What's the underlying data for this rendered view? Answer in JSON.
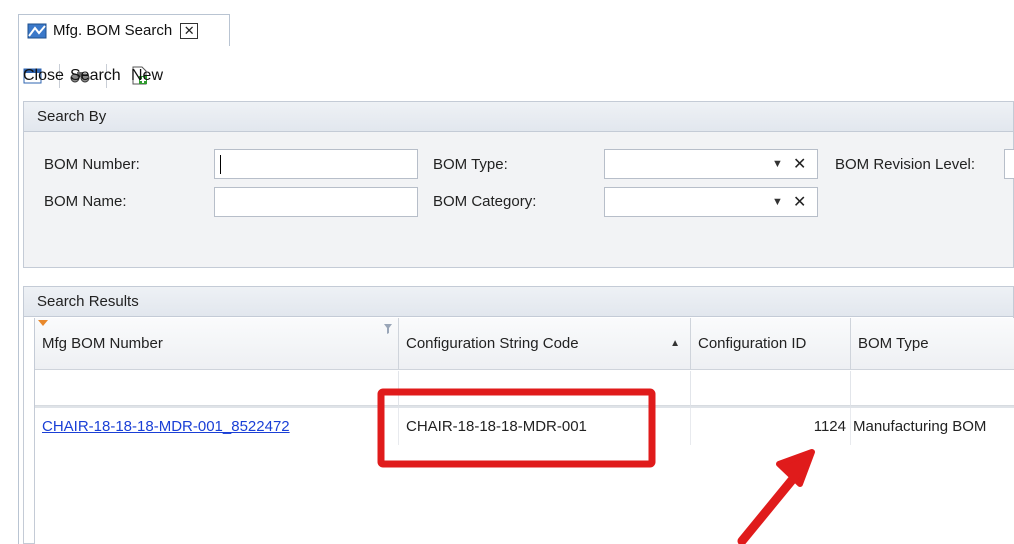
{
  "tab": {
    "title": "Mfg. BOM Search",
    "icon": "bom-search-icon",
    "close_icon": "close-icon"
  },
  "toolbar": {
    "close_label": "Close",
    "search_label": "Search",
    "new_label": "New"
  },
  "search_by": {
    "title": "Search By",
    "bom_number_label": "BOM Number:",
    "bom_number_value": "",
    "bom_name_label": "BOM Name:",
    "bom_name_value": "",
    "bom_type_label": "BOM Type:",
    "bom_type_value": "",
    "bom_category_label": "BOM Category:",
    "bom_category_value": "",
    "bom_revision_label": "BOM Revision Level:"
  },
  "results": {
    "title": "Search Results",
    "columns": [
      "Mfg BOM Number",
      "Configuration String Code",
      "Configuration ID",
      "BOM Type"
    ],
    "sorted_column": "Configuration String Code",
    "rows": [
      {
        "mfg_bom_number": "CHAIR-18-18-18-MDR-001_8522472",
        "configuration_string_code": "CHAIR-18-18-18-MDR-001",
        "configuration_id": "1124",
        "bom_type": "Manufacturing BOM"
      }
    ]
  },
  "annotation": {
    "highlight_color": "#e01b1b",
    "arrow_color": "#e01b1b"
  }
}
